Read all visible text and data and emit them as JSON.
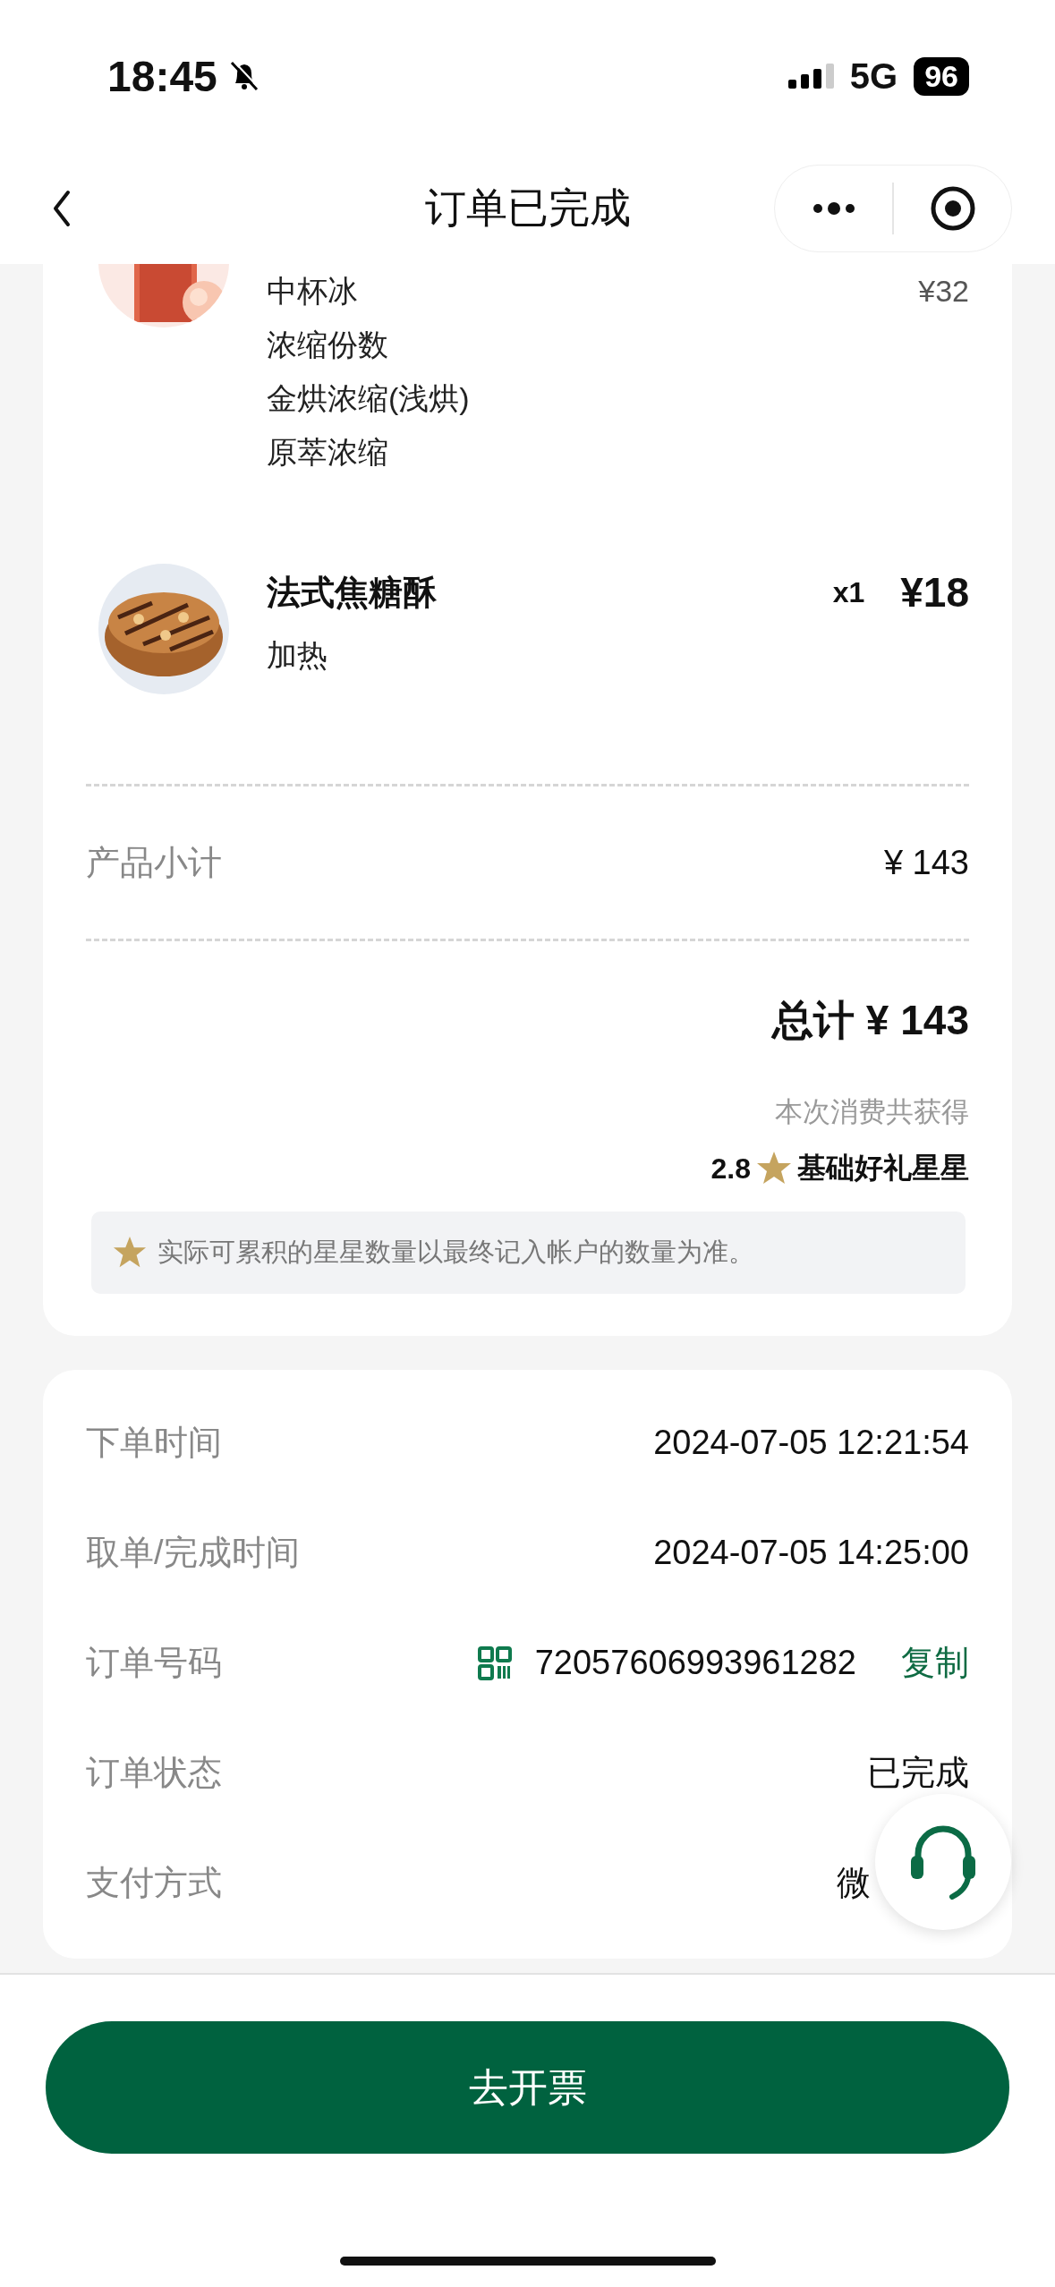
{
  "status_bar": {
    "time": "18:45",
    "silent": true,
    "network": "5G",
    "battery": "96"
  },
  "nav": {
    "title": "订单已完成"
  },
  "items": [
    {
      "options": [
        "中杯冰",
        "浓缩份数",
        "金烘浓缩(浅烘)",
        "原萃浓缩"
      ],
      "original_price": "¥32"
    },
    {
      "name": "法式焦糖酥",
      "quantity": "x1",
      "price": "¥18",
      "options": [
        "加热"
      ]
    }
  ],
  "subtotal": {
    "label": "产品小计",
    "value": "¥ 143"
  },
  "total": "总计 ¥ 143",
  "rewards": {
    "caption": "本次消费共获得",
    "points": "2.8",
    "reward": "基础好礼星星",
    "tip": "实际可累积的星星数量以最终记入帐户的数量为准。"
  },
  "details": [
    {
      "kind": "text",
      "label": "下单时间",
      "value": "2024-07-05 12:21:54"
    },
    {
      "kind": "text",
      "label": "取单/完成时间",
      "value": "2024-07-05 14:25:00"
    },
    {
      "kind": "order_number",
      "label": "订单号码",
      "value": "72057606993961282",
      "action": "复制"
    },
    {
      "kind": "text",
      "label": "订单状态",
      "value": "已完成"
    },
    {
      "kind": "text",
      "label": "支付方式",
      "value": "微"
    }
  ],
  "invoice_button": "去开票"
}
